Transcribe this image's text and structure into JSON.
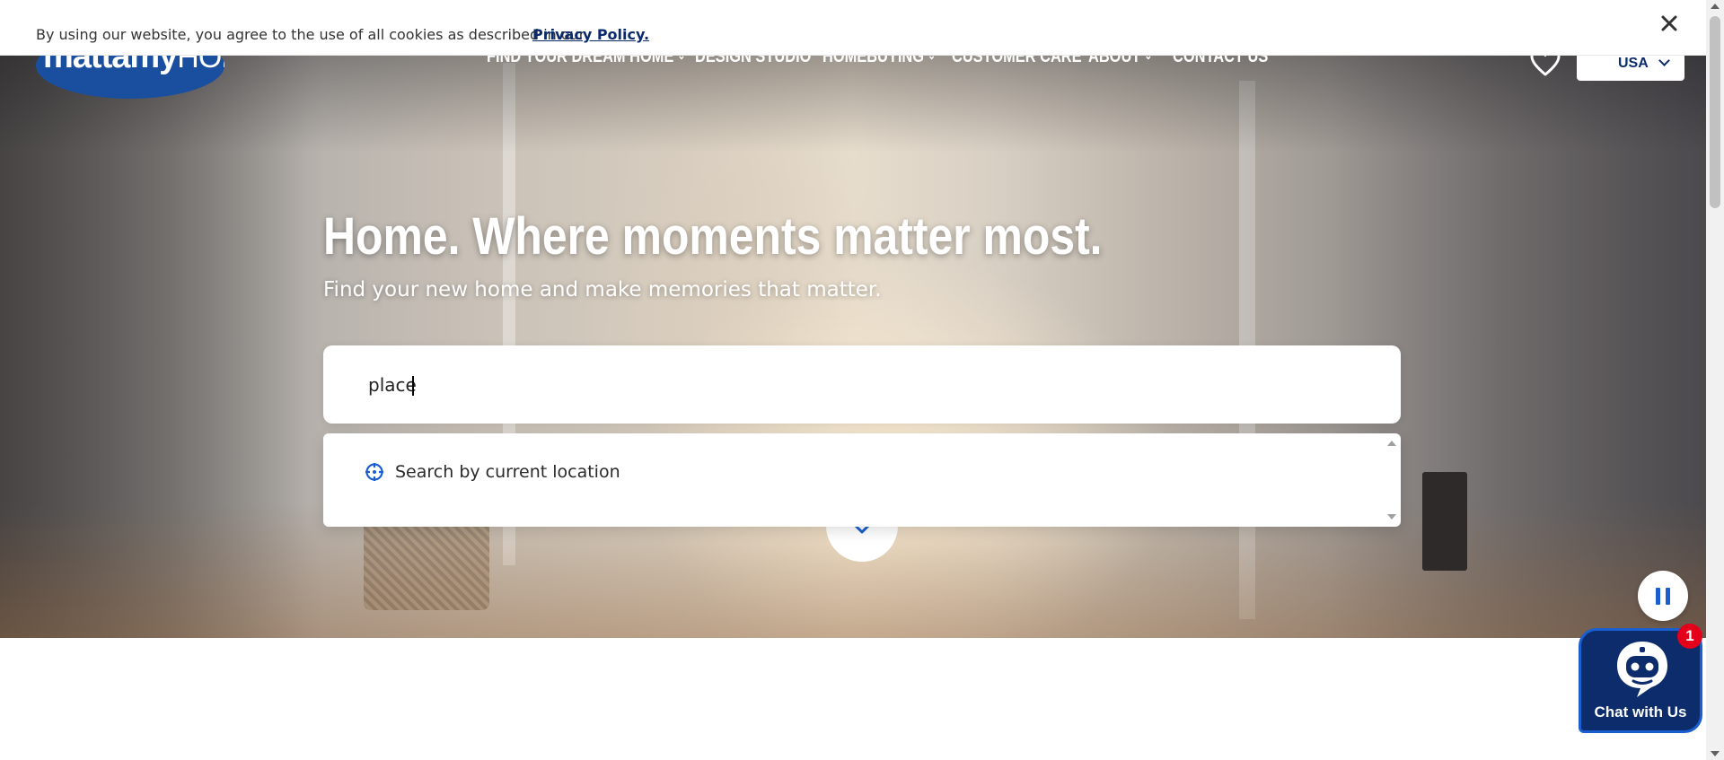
{
  "cookie_banner": {
    "text": "By using our website, you agree to the use of all cookies as described in our",
    "link_label": "Privacy Policy.",
    "close_icon": "close-icon"
  },
  "header": {
    "logo_text_bold": "mattamy",
    "logo_text_light": "HOMES",
    "nav": [
      {
        "label": "FIND YOUR DREAM HOME",
        "has_dropdown": true
      },
      {
        "label": "DESIGN STUDIO",
        "has_dropdown": false
      },
      {
        "label": "HOMEBUYING",
        "has_dropdown": true
      },
      {
        "label": "CUSTOMER CARE",
        "has_dropdown": false
      },
      {
        "label": "ABOUT",
        "has_dropdown": true
      },
      {
        "label": "CONTACT US",
        "has_dropdown": false
      }
    ],
    "favorites_icon": "heart-icon",
    "country": "USA"
  },
  "hero": {
    "title": "Home. Where moments matter most.",
    "subtitle": "Find your new home and make memories that matter.",
    "search": {
      "value": "place",
      "placeholder": ""
    },
    "suggestions": [
      {
        "label": "Search by current location",
        "icon": "location-target-icon"
      }
    ]
  },
  "video_control": {
    "icon": "pause-icon"
  },
  "chat": {
    "label": "Chat with Us",
    "badge_count": "1",
    "icon": "chatbot-icon"
  },
  "colors": {
    "brand_navy": "#0d2c6c",
    "brand_blue": "#1a5fd0",
    "logo_blue": "#1a4fa0",
    "badge_red": "#e4001b"
  }
}
